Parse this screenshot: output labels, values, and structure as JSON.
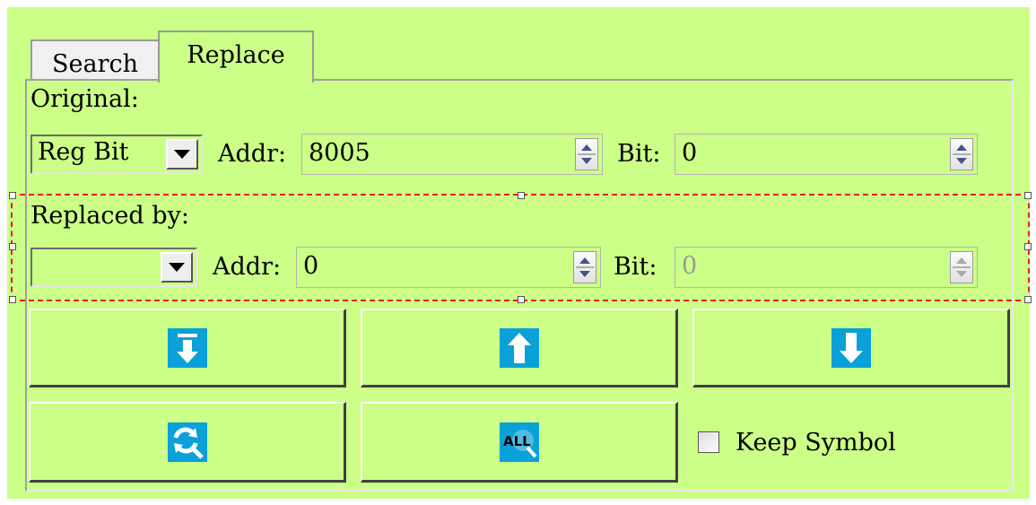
{
  "tabs": [
    {
      "label": "Search",
      "active": false
    },
    {
      "label": "Replace",
      "active": true
    }
  ],
  "original": {
    "section_label": "Original:",
    "type_value": "Reg Bit",
    "addr_label": "Addr:",
    "addr_value": "8005",
    "bit_label": "Bit:",
    "bit_value": "0"
  },
  "replaced_by": {
    "section_label": "Replaced by:",
    "type_value": "",
    "addr_label": "Addr:",
    "addr_value": "0",
    "bit_label": "Bit:",
    "bit_value": "0",
    "bit_disabled": true
  },
  "buttons": [
    {
      "name": "find-first",
      "icon": "arrow-down-to-bar-icon"
    },
    {
      "name": "find-previous",
      "icon": "arrow-up-icon"
    },
    {
      "name": "find-next",
      "icon": "arrow-down-icon"
    },
    {
      "name": "replace",
      "icon": "replace-magnifier-icon"
    },
    {
      "name": "replace-all",
      "icon": "replace-all-icon",
      "icon_text": "ALL"
    }
  ],
  "keep_symbol": {
    "label": "Keep Symbol",
    "checked": false
  },
  "colors": {
    "panel_bg": "#ccff88",
    "icon_bg": "#0aa0d8",
    "selection": "#e02020"
  }
}
